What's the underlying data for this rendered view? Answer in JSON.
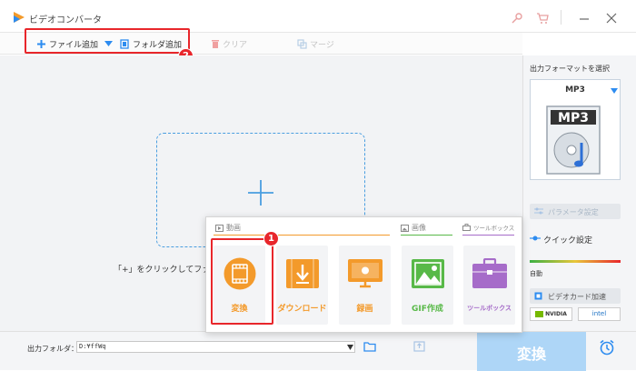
{
  "window": {
    "title": "ビデオコンバータ"
  },
  "toolbar": {
    "add_file_label": "ファイル追加",
    "add_folder_label": "フォルダ追加",
    "clear_label": "クリア",
    "merge_label": "マージ"
  },
  "callouts": {
    "step1": "1",
    "step2": "2"
  },
  "main": {
    "hint": "「+」をクリックしてファイ"
  },
  "popup": {
    "categories": {
      "video": "動画",
      "image": "画像",
      "toolbox": "ツールボックス"
    },
    "tiles": [
      {
        "label": "変換",
        "icon": "film-icon"
      },
      {
        "label": "ダウンロード",
        "icon": "download-icon"
      },
      {
        "label": "録画",
        "icon": "screen-record-icon"
      },
      {
        "label": "GIF作成",
        "icon": "image-icon"
      },
      {
        "label": "ツールボックス",
        "icon": "toolbox-icon"
      }
    ]
  },
  "right_panel": {
    "format_title": "出力フォーマットを選択",
    "format_value": "MP3",
    "format_badge": "MP3",
    "param_settings": "パラメータ設定",
    "quick_settings": "クイック設定",
    "auto_label": "自動",
    "gpu_accel": "ビデオカード加速",
    "vendor_nvidia": "NVIDIA",
    "vendor_intel": "intel"
  },
  "bottom": {
    "output_folder_label": "出力フォルダ：",
    "output_path": "D:¥ffWq",
    "convert_label": "変換"
  },
  "colors": {
    "accent_orange": "#f39a2b",
    "callout_red": "#e8262b",
    "accent_blue": "#2d8cf0",
    "gif_green": "#58b948",
    "toolbox_purple": "#a66cc9"
  }
}
